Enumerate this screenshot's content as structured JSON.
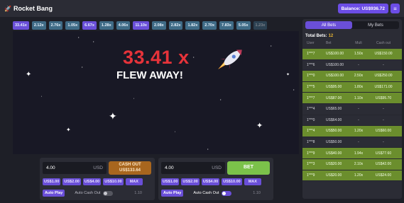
{
  "app": {
    "title": "Rocket Bang",
    "balance": "Balance: US$936.72"
  },
  "multipliers": [
    {
      "v": "33.41x",
      "c": "purple"
    },
    {
      "v": "2.12x",
      "c": "blue"
    },
    {
      "v": "2.76x",
      "c": "blue"
    },
    {
      "v": "1.05x",
      "c": "blue"
    },
    {
      "v": "6.67x",
      "c": "purple"
    },
    {
      "v": "1.28x",
      "c": "blue"
    },
    {
      "v": "4.06x",
      "c": "blue"
    },
    {
      "v": "11.10x",
      "c": "purple"
    },
    {
      "v": "2.08x",
      "c": "blue"
    },
    {
      "v": "2.82x",
      "c": "blue"
    },
    {
      "v": "1.82x",
      "c": "blue"
    },
    {
      "v": "2.70x",
      "c": "blue"
    },
    {
      "v": "7.83x",
      "c": "blue"
    },
    {
      "v": "5.05x",
      "c": "blue"
    },
    {
      "v": "1.23x",
      "c": "fade"
    }
  ],
  "game": {
    "crash_value": "33.41 x",
    "crash_text": "FLEW AWAY!"
  },
  "panel1": {
    "amount": "4.00",
    "currency": "USD",
    "action_line1": "CASH OUT",
    "action_line2": "US$133.64",
    "quick": [
      "US$1.00",
      "US$2.00",
      "US$4.00",
      "US$10.00",
      "MAX"
    ],
    "auto_play": "Auto Play",
    "auto_cash_out": "Auto Cash Out",
    "cash_value": "1.10"
  },
  "panel2": {
    "amount": "4.00",
    "currency": "USD",
    "action_line1": "BET",
    "quick": [
      "US$1.00",
      "US$2.00",
      "US$4.00",
      "US$10.00",
      "MAX"
    ],
    "auto_play": "Auto Play",
    "auto_cash_out": "Auto Cash Out",
    "cash_value": "1.10"
  },
  "bets": {
    "tabs": [
      "All Bets",
      "My Bets"
    ],
    "total_label": "Total Bets:",
    "total": "12",
    "headers": [
      "User",
      "Bet",
      "Mult",
      "Cash out"
    ],
    "rows": [
      {
        "user": "1***7",
        "bet": "US$100.00",
        "mult": "1.50x",
        "cash": "US$150.00",
        "win": true
      },
      {
        "user": "1***6",
        "bet": "US$100.00",
        "mult": "-",
        "cash": "-",
        "win": false
      },
      {
        "user": "1***0",
        "bet": "US$100.00",
        "mult": "2.50x",
        "cash": "US$250.00",
        "win": true
      },
      {
        "user": "1***5",
        "bet": "US$95.00",
        "mult": "1.80x",
        "cash": "US$171.00",
        "win": true
      },
      {
        "user": "1***7",
        "bet": "US$87.00",
        "mult": "1.10x",
        "cash": "US$95.70",
        "win": true
      },
      {
        "user": "1***4",
        "bet": "US$65.00",
        "mult": "-",
        "cash": "-",
        "win": false
      },
      {
        "user": "1***0",
        "bet": "US$64.00",
        "mult": "-",
        "cash": "-",
        "win": false
      },
      {
        "user": "1***4",
        "bet": "US$50.00",
        "mult": "1.20x",
        "cash": "US$60.00",
        "win": true
      },
      {
        "user": "1***8",
        "bet": "US$50.00",
        "mult": "-",
        "cash": "-",
        "win": false
      },
      {
        "user": "1***9",
        "bet": "US$40.00",
        "mult": "1.94x",
        "cash": "US$77.60",
        "win": true
      },
      {
        "user": "1***3",
        "bet": "US$20.00",
        "mult": "2.10x",
        "cash": "US$42.00",
        "win": true
      },
      {
        "user": "1***9",
        "bet": "US$20.00",
        "mult": "1.20x",
        "cash": "US$24.00",
        "win": true
      }
    ]
  }
}
